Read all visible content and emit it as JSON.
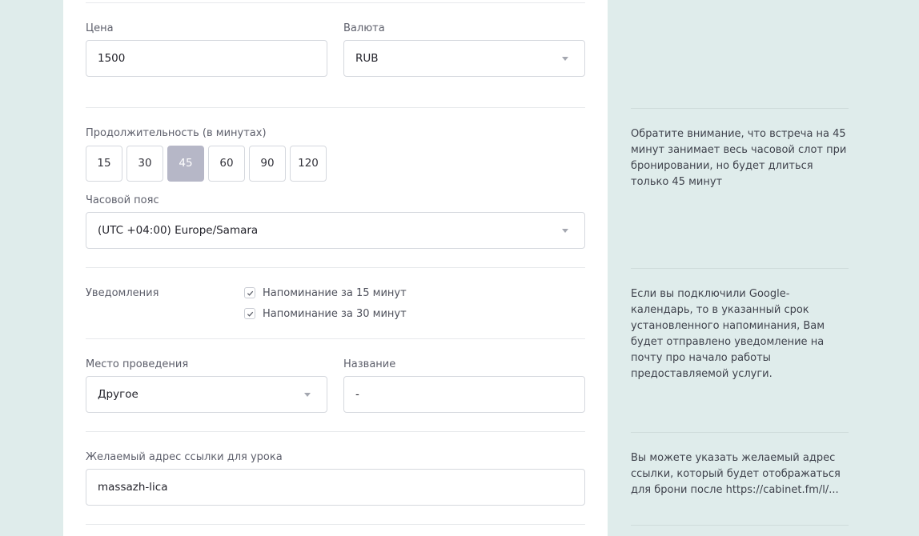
{
  "price": {
    "label": "Цена",
    "value": "1500"
  },
  "currency": {
    "label": "Валюта",
    "value": "RUB"
  },
  "duration": {
    "label": "Продолжительность (в минутах)",
    "options": [
      "15",
      "30",
      "45",
      "60",
      "90",
      "120"
    ],
    "selected": "45"
  },
  "timezone": {
    "label": "Часовой пояс",
    "value": "(UTC +04:00) Europe/Samara"
  },
  "notifications": {
    "label": "Уведомления",
    "items": [
      {
        "label": "Напоминание за 15 минут",
        "checked": true
      },
      {
        "label": "Напоминание за 30 минут",
        "checked": true
      }
    ]
  },
  "location": {
    "label": "Место проведения",
    "value": "Другое"
  },
  "name": {
    "label": "Название",
    "value": "-"
  },
  "link": {
    "label": "Желаемый адрес ссылки для урока",
    "value": "massazh-lica"
  },
  "notes": {
    "duration": "Обратите внимание, что встреча на 45 минут занимает весь часовой слот при бронировании, но будет длиться только 45 минут",
    "notifications": "Если вы подключили Google-календарь, то в указанный срок установленного напоминания, Вам будет отправлено уведомление на почту про начало работы предоставляемой услуги.",
    "link": "Вы можете указать желаемый адрес ссылки, который будет отображаться для брони после https://cabinet.fm/l/..."
  },
  "colors": {
    "background": "#dfeceb",
    "selected_duration": "#b6b7c7",
    "border": "#d5d8de"
  }
}
